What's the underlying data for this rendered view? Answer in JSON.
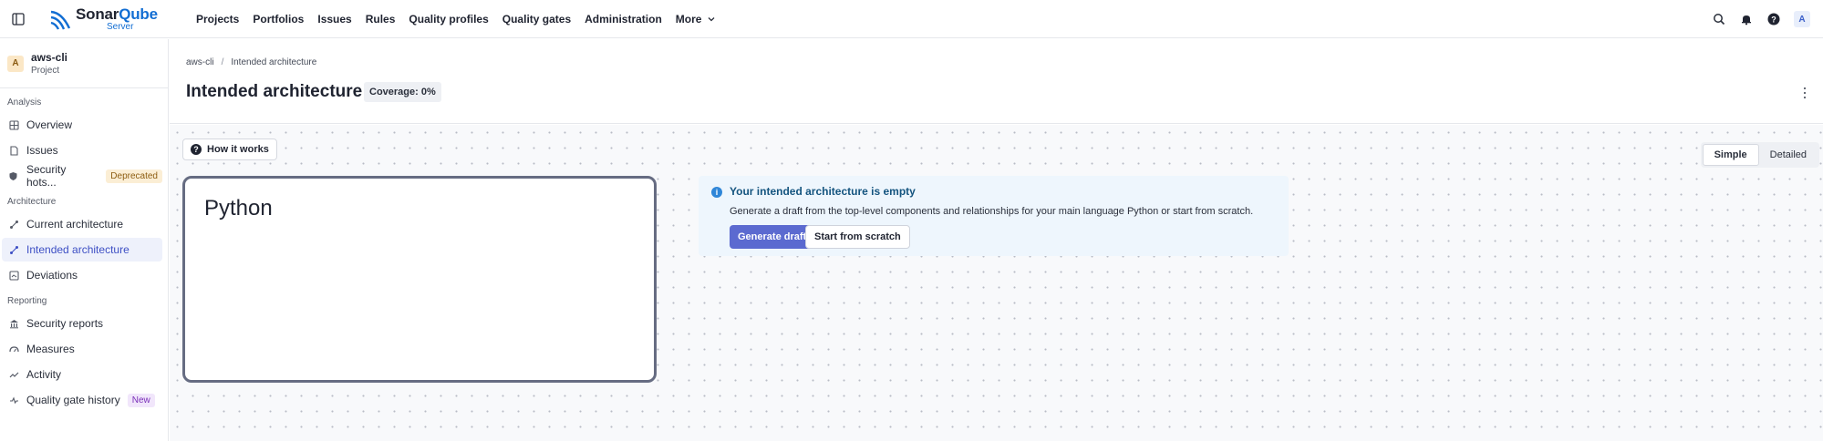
{
  "brand": {
    "name_a": "Sonar",
    "name_b": "Qube",
    "sub": "Server",
    "accent": "#126ed3"
  },
  "nav": {
    "items": [
      "Projects",
      "Portfolios",
      "Issues",
      "Rules",
      "Quality profiles",
      "Quality gates",
      "Administration"
    ],
    "more": "More",
    "avatar": "A"
  },
  "project": {
    "avatar": "A",
    "name": "aws-cli",
    "type": "Project"
  },
  "sidebar": {
    "analysis": "Analysis",
    "overview": "Overview",
    "issues": "Issues",
    "hotspots": "Security hots...",
    "deprecated": "Deprecated",
    "architecture": "Architecture",
    "current_arch": "Current architecture",
    "intended_arch": "Intended architecture",
    "deviations": "Deviations",
    "reporting": "Reporting",
    "security_reports": "Security reports",
    "measures": "Measures",
    "activity": "Activity",
    "qg_history": "Quality gate history",
    "new": "New"
  },
  "breadcrumb": {
    "project": "aws-cli",
    "sep": "/",
    "page": "Intended architecture"
  },
  "header": {
    "title": "Intended architecture",
    "coverage": "Coverage: 0%"
  },
  "canvas": {
    "how_it_works": "How it works",
    "component": "Python",
    "empty_title": "Your intended architecture is empty",
    "empty_desc": "Generate a draft from the top-level components and relationships for your main language Python or start from scratch.",
    "generate": "Generate draft",
    "scratch": "Start from scratch",
    "view_simple": "Simple",
    "view_detailed": "Detailed"
  },
  "colors": {
    "primary_button": "#5b6ad0",
    "active_nav": "#3d4fc4",
    "info": "#2f86d8"
  }
}
